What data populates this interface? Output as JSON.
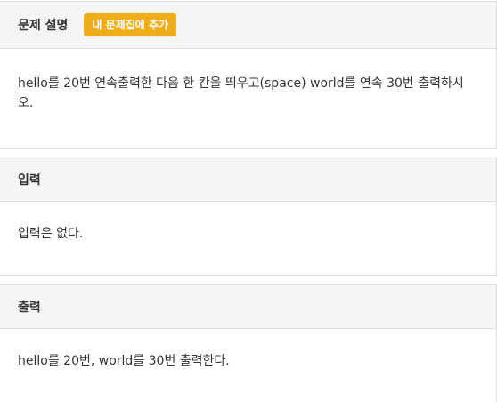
{
  "sections": [
    {
      "title": "문제 설명",
      "button": "내 문제집에 추가",
      "body": "hello를 20번 연속출력한 다음 한 칸을 띄우고(space) world를 연속 30번 출력하시오."
    },
    {
      "title": "입력",
      "body": "입력은 없다."
    },
    {
      "title": "출력",
      "body": "hello를 20번, world를 30번 출력한다."
    }
  ],
  "colors": {
    "button_bg": "#f0ad1a",
    "heading_bg": "#f5f5f5",
    "border": "#dddddd"
  }
}
